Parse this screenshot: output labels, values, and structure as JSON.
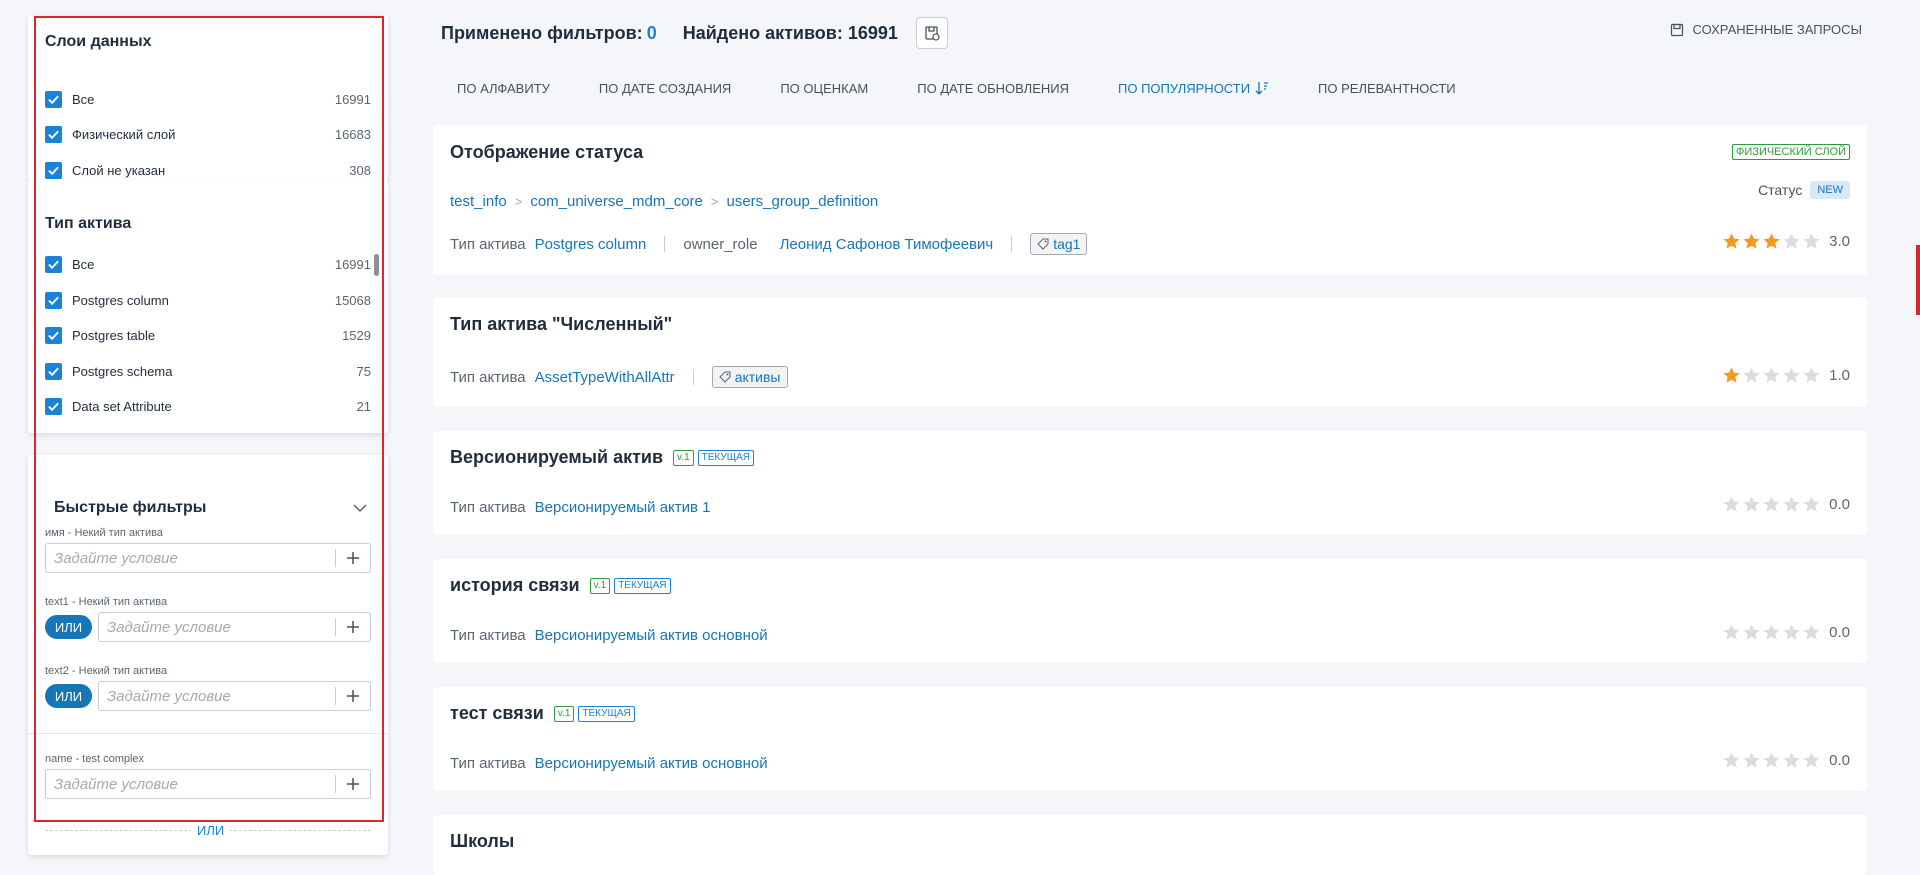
{
  "sidebar": {
    "layers": {
      "title": "Слои данных",
      "items": [
        {
          "label": "Все",
          "count": "16991"
        },
        {
          "label": "Физический слой",
          "count": "16683"
        },
        {
          "label": "Слой не указан",
          "count": "308"
        }
      ]
    },
    "asset_types": {
      "title": "Тип актива",
      "items": [
        {
          "label": "Все",
          "count": "16991"
        },
        {
          "label": "Postgres column",
          "count": "15068"
        },
        {
          "label": "Postgres table",
          "count": "1529"
        },
        {
          "label": "Postgres schema",
          "count": "75"
        },
        {
          "label": "Data set Attribute",
          "count": "21"
        }
      ]
    },
    "quick_filters": {
      "title": "Быстрые фильтры",
      "placeholder": "Задайте условие",
      "or_label": "ИЛИ",
      "or_separator": "ИЛИ",
      "filters": [
        {
          "label": "имя - Некий тип актива"
        },
        {
          "label": "text1 - Некий тип актива"
        },
        {
          "label": "text2 - Некий тип актива"
        },
        {
          "label": "name - test complex"
        }
      ]
    }
  },
  "header": {
    "applied_label": "Применено фильтров:",
    "applied_count": "0",
    "found_label": "Найдено активов: 16991",
    "saved_queries": "СОХРАНЕННЫЕ ЗАПРОСЫ",
    "save_icon": "save-query-icon"
  },
  "sort_tabs": [
    {
      "label": "ПО АЛФАВИТУ"
    },
    {
      "label": "ПО ДАТЕ СОЗДАНИЯ"
    },
    {
      "label": "ПО ОЦЕНКАМ"
    },
    {
      "label": "ПО ДАТЕ ОБНОВЛЕНИЯ"
    },
    {
      "label": "ПО ПОПУЛЯРНОСТИ",
      "active": true
    },
    {
      "label": "ПО РЕЛЕВАНТНОСТИ"
    }
  ],
  "assets": [
    {
      "title": "Отображение статуса",
      "layer_tag": "ФИЗИЧЕСКИЙ СЛОЙ",
      "status_label": "Статус",
      "status_value": "NEW",
      "breadcrumb": [
        "test_info",
        "com_universe_mdm_core",
        "users_group_definition"
      ],
      "type_label": "Тип актива",
      "type_value": "Postgres column",
      "role": "owner_role",
      "person": "Леонид Сафонов Тимофеевич",
      "chip": "tag1",
      "rating": 3,
      "rating_text": "3.0"
    },
    {
      "title": "Тип актива \"Численный\"",
      "type_label": "Тип актива",
      "type_value": "AssetTypeWithAllAttr",
      "chip": "активы",
      "rating": 1,
      "rating_text": "1.0"
    },
    {
      "title": "Версионируемый актив",
      "version": "v.1",
      "current": "ТЕКУЩАЯ",
      "type_label": "Тип актива",
      "type_value": "Версионируемый актив 1",
      "rating": 0,
      "rating_text": "0.0"
    },
    {
      "title": "история связи",
      "version": "v.1",
      "current": "ТЕКУЩАЯ",
      "type_label": "Тип актива",
      "type_value": "Версионируемый актив основной",
      "rating": 0,
      "rating_text": "0.0"
    },
    {
      "title": "тест связи",
      "version": "v.1",
      "current": "ТЕКУЩАЯ",
      "type_label": "Тип актива",
      "type_value": "Версионируемый актив основной",
      "rating": 0,
      "rating_text": "0.0"
    },
    {
      "title": "Школы"
    }
  ],
  "colors": {
    "accent": "#1576b8",
    "checkbox": "#1a82d9",
    "star_on": "#f29a1f",
    "star_off": "#d9dde2",
    "physical_tag": "#2e9e3a",
    "highlight_frame": "#e0242e"
  }
}
